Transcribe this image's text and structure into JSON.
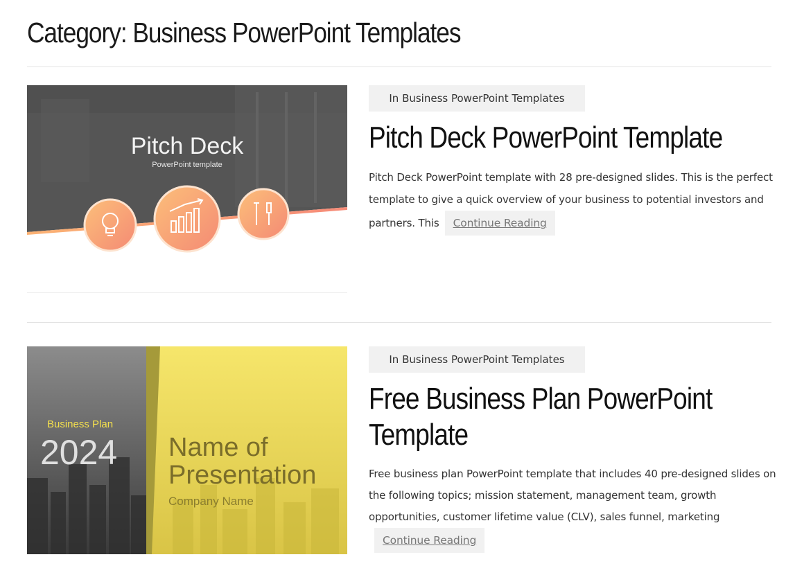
{
  "page": {
    "title": "Category: Business PowerPoint Templates"
  },
  "articles": [
    {
      "category": "In Business PowerPoint Templates",
      "title": "Pitch Deck PowerPoint Template",
      "excerpt": "Pitch Deck PowerPoint template with 28 pre-designed slides. This is the perfect template to give a quick overview of your business to potential investors and partners. This",
      "read_more": "Continue Reading",
      "thumbnail": {
        "heading": "Pitch Deck",
        "subheading": "PowerPoint template",
        "icons": [
          "lightbulb-icon",
          "bar-chart-icon",
          "tools-icon"
        ],
        "accent": "#f9a070",
        "background": "#555555"
      }
    },
    {
      "category": "In Business PowerPoint Templates",
      "title": "Free Business Plan PowerPoint Template",
      "excerpt": "Free business plan PowerPoint template that includes 40 pre-designed slides on the following topics; mission statement, management team, growth opportunities, customer lifetime value (CLV), sales funnel, marketing",
      "read_more": "Continue Reading",
      "thumbnail": {
        "label": "Business Plan",
        "year": "2024",
        "name_line1": "Name of",
        "name_line2": "Presentation",
        "company": "Company Name",
        "accent": "#f4e04d"
      }
    }
  ]
}
